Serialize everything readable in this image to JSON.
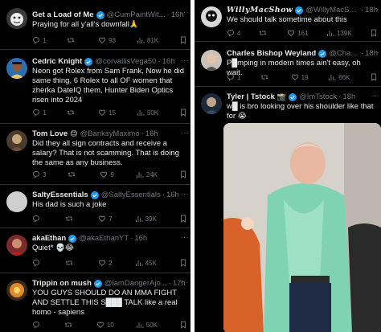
{
  "left_tweets": [
    {
      "name": "Get a Load of Me",
      "handle": "@CumPaintWit...",
      "time": "16h",
      "text": "Praying for all y'all's downfall🙏",
      "replies": "1",
      "retweets": "",
      "likes": "93",
      "views": "81K"
    },
    {
      "name": "Cedric Knight",
      "handle": "@corvallisVega50",
      "time": "16h",
      "text": "Neon got Rolex from Sam Frank, Now he did same thing, 6 Rolex to all OF women that zherka DateIQ them, Hunter Biden Optics risen into 2024",
      "replies": "1",
      "retweets": "",
      "likes": "15",
      "views": "50K"
    },
    {
      "name": "Tom Love",
      "handle": "@BanksyMaximo",
      "time": "16h",
      "text": "Did they all sign contracts and receive a salary? That is not scamming. That is doing the same as any business.",
      "replies": "3",
      "retweets": "",
      "likes": "9",
      "views": "24K"
    },
    {
      "name": "SaltyEssentials",
      "handle": "@SaltyEssentials",
      "time": "16h",
      "text": "His dad is such a joke",
      "replies": "",
      "retweets": "",
      "likes": "7",
      "views": "39K"
    },
    {
      "name": "akaEthan",
      "handle": "@akaEthanYT",
      "time": "16h",
      "text": "Quiet* 💀😂",
      "replies": "",
      "retweets": "",
      "likes": "2",
      "views": "45K"
    },
    {
      "name": "Trippin on mush",
      "handle": "@iamDangerAjo...",
      "time": "17h",
      "text": "YOU GUYS SHOULD DO AN MMA FIGHT AND SETTLE THIS S███ TALK like a real homo - sapiens",
      "replies": "",
      "retweets": "",
      "likes": "10",
      "views": "50K"
    }
  ],
  "right_tweets": [
    {
      "name": "WillyMacShow",
      "handle": "@WillyMacSh...",
      "time": "18h",
      "text": "We should talk sometime about this",
      "replies": "4",
      "retweets": "",
      "likes": "161",
      "views": "139K"
    },
    {
      "name": "Charles Bishop Weyland",
      "handle": "@Charl...",
      "time": "18h",
      "text": "P█mping in modern times ain't easy, oh wait.",
      "replies": "1",
      "retweets": "",
      "likes": "19",
      "views": "66K"
    },
    {
      "name": "Tyler | Tstock",
      "handle": "@ImTstock",
      "time": "18h",
      "text": "w█ is bro looking over his shoulder like that for 😭",
      "replies": "",
      "retweets": "",
      "likes": "",
      "views": ""
    }
  ],
  "colors": {
    "background": "#000000",
    "text": "#e7e9ea",
    "muted": "#71767b",
    "verified": "#1d9bf0",
    "divider": "#2f3336"
  },
  "icons": [
    "reply-icon",
    "retweet-icon",
    "like-icon",
    "views-icon",
    "bookmark-icon",
    "verified-badge-icon",
    "more-icon",
    "pray-emoji",
    "skull-emoji",
    "laugh-emoji",
    "cry-emoji"
  ]
}
